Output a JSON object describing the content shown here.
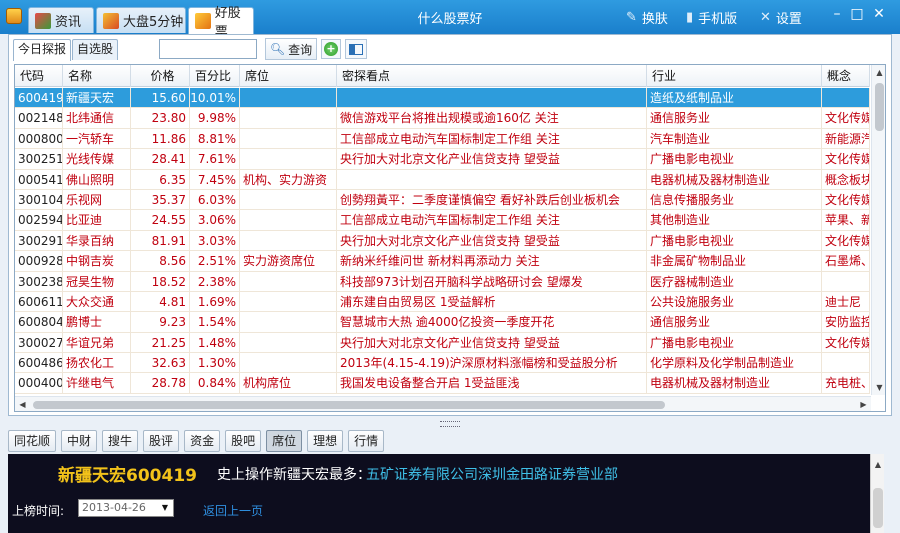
{
  "titlebar": {
    "tabs": [
      {
        "label": "资讯"
      },
      {
        "label": "大盘5分钟"
      },
      {
        "label": "好股票"
      }
    ],
    "title": "什么股票好",
    "skin_label": "换肤",
    "mobile_label": "手机版",
    "settings_label": "设置"
  },
  "toolbar": {
    "subtabs": [
      {
        "label": "今日探报"
      },
      {
        "label": "自选股"
      }
    ],
    "search_value": "",
    "query_label": "查询",
    "add_icon": "+"
  },
  "table": {
    "columns": [
      "代码",
      "名称",
      "价格",
      "百分比",
      "席位",
      "密探看点",
      "行业",
      "概念"
    ],
    "rows": [
      [
        "600419",
        "新疆天宏",
        "15.60",
        "10.01%",
        "",
        "",
        "造纸及纸制品业",
        ""
      ],
      [
        "002148",
        "北纬通信",
        "23.80",
        "9.98%",
        "",
        "微信游戏平台将推出规模或逾160亿 关注",
        "通信服务业",
        "文化传媒"
      ],
      [
        "000800",
        "一汽轿车",
        "11.86",
        "8.81%",
        "",
        "工信部成立电动汽车国标制定工作组 关注",
        "汽车制造业",
        "新能源汽"
      ],
      [
        "300251",
        "光线传媒",
        "28.41",
        "7.61%",
        "",
        "央行加大对北京文化产业信贷支持 望受益",
        "广播电影电视业",
        "文化传媒"
      ],
      [
        "000541",
        "佛山照明",
        "6.35",
        "7.45%",
        "机构、实力游资",
        "",
        "电器机械及器材制造业",
        "概念板块"
      ],
      [
        "300104",
        "乐视网",
        "35.37",
        "6.03%",
        "",
        "创勢翔黃平：二季度谨慎偏空 看好补跌后创业板机会",
        "信息传播服务业",
        "文化传媒"
      ],
      [
        "002594",
        "比亚迪",
        "24.55",
        "3.06%",
        "",
        "工信部成立电动汽车国标制定工作组 关注",
        "其他制造业",
        "苹果、新"
      ],
      [
        "300291",
        "华录百纳",
        "81.91",
        "3.03%",
        "",
        "央行加大对北京文化产业信贷支持 望受益",
        "广播电影电视业",
        "文化传媒"
      ],
      [
        "000928",
        "中钢吉炭",
        "8.56",
        "2.51%",
        "实力游资席位",
        "新纳米纤维问世 新材料再添动力 关注",
        "非金属矿物制品业",
        "石墨烯、"
      ],
      [
        "300238",
        "冠昊生物",
        "18.52",
        "2.38%",
        "",
        "科技部973计划召开脑科学战略研讨会 望爆发",
        "医疗器械制造业",
        ""
      ],
      [
        "600611",
        "大众交通",
        "4.81",
        "1.69%",
        "",
        "浦东建自由贸易区 1受益解析",
        "公共设施服务业",
        "迪士尼"
      ],
      [
        "600804",
        "鹏博士",
        "9.23",
        "1.54%",
        "",
        "智慧城市大热 逾4000亿投资一季度开花",
        "通信服务业",
        "安防监控"
      ],
      [
        "300027",
        "华谊兄弟",
        "21.25",
        "1.48%",
        "",
        "央行加大对北京文化产业信贷支持 望受益",
        "广播电影电视业",
        "文化传媒"
      ],
      [
        "600486",
        "扬农化工",
        "32.63",
        "1.30%",
        "",
        "2013年(4.15-4.19)沪深原材料涨幅榜和受益股分析",
        "化学原料及化学制品制造业",
        ""
      ],
      [
        "000400",
        "许继电气",
        "28.78",
        "0.84%",
        "机构席位",
        "我国发电设备整合开启 1受益匪浅",
        "电器机械及器材制造业",
        "充电桩、"
      ]
    ]
  },
  "bottom_tabs": [
    {
      "label": "同花顺"
    },
    {
      "label": "中财"
    },
    {
      "label": "搜牛"
    },
    {
      "label": "股评"
    },
    {
      "label": "资金"
    },
    {
      "label": "股吧"
    },
    {
      "label": "席位"
    },
    {
      "label": "理想"
    },
    {
      "label": "行情"
    }
  ],
  "detail": {
    "stock_title": "新疆天宏600419",
    "info_prefix": "史上操作新疆天宏最多：",
    "broker": "五矿证券有限公司深圳金田路证券营业部",
    "date_label": "上榜时间:",
    "date_value": "2013-04-26",
    "back_link": "返回上一页"
  },
  "colors": {
    "titlebar": "#1a7fcc",
    "selected_row": "#2d9cdc",
    "row_text": "#c0000f",
    "stock_title": "#f2c21a",
    "broker": "#3fc0e8"
  }
}
